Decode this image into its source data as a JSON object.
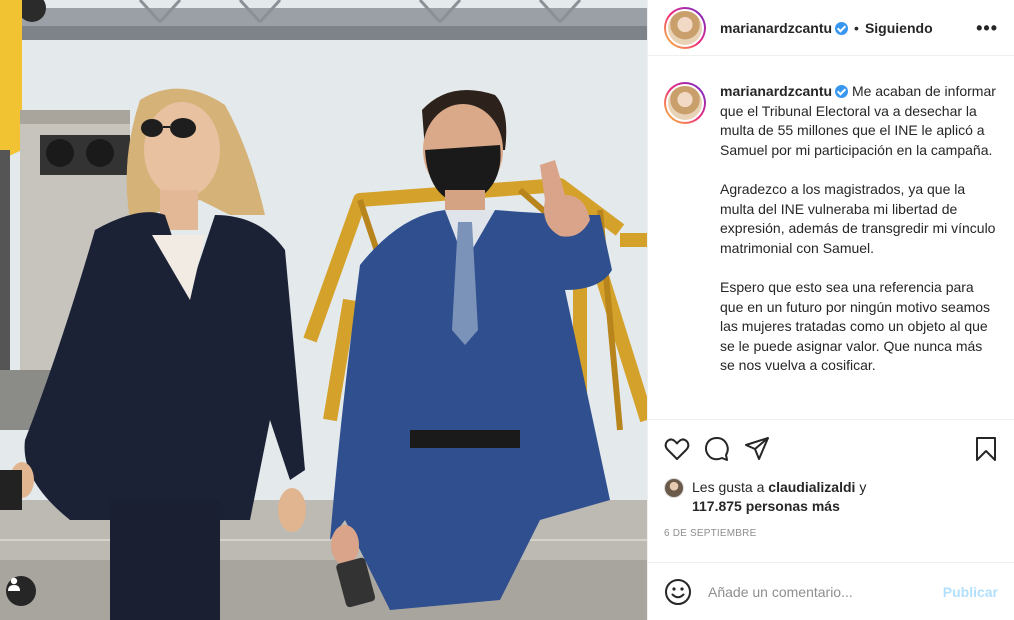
{
  "post": {
    "username": "marianardzcantu",
    "separator": "•",
    "following_label": "Siguiendo",
    "more_icon": "more-options-icon",
    "more_glyph": "•••"
  },
  "caption": {
    "username": "marianardzcantu",
    "paragraphs": [
      "Me acaban de informar que el Tribunal Electoral va a desechar la multa de 55 millones que el INE le aplicó a Samuel por mi participación en la campaña.",
      "Agradezco a los magistrados, ya que la multa del INE vulneraba mi libertad de expresión, además de transgredir mi vínculo matrimonial con Samuel.",
      "Espero que esto sea una referencia para que en un futuro por ningún motivo seamos las mujeres tratadas como un objeto al que se le puede asignar valor. Que nunca más se nos vuelva a cosificar."
    ]
  },
  "actions": {
    "icons": [
      "heart-icon",
      "comment-icon",
      "share-icon",
      "bookmark-icon"
    ]
  },
  "likes": {
    "prefix": "Les gusta a",
    "liked_by": "claudializaldi",
    "connector": "y",
    "others": "117.875 personas más"
  },
  "date": "6 DE SEPTIEMBRE",
  "comment": {
    "placeholder": "Añade un comentario...",
    "publish_label": "Publicar"
  },
  "colors": {
    "verified": "#3897f0",
    "publish_disabled": "#b2dffc",
    "muted_text": "#8e8e8e"
  }
}
